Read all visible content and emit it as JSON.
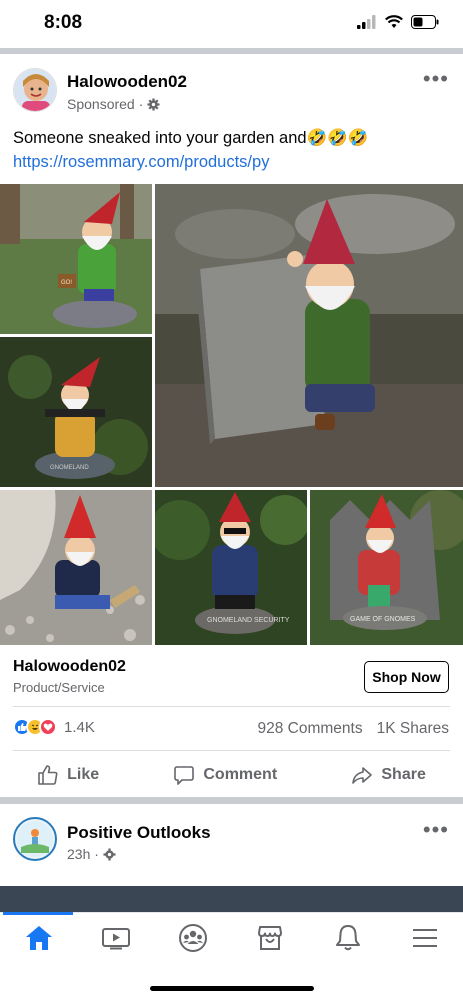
{
  "status_bar": {
    "time": "8:08"
  },
  "post": {
    "author": "Halowooden02",
    "meta": "Sponsored ·",
    "text_before_link": "Someone sneaked into your garden and🤣🤣🤣",
    "link_text": "https://rosemmary.com/products/py",
    "gnome_signs": [
      "GNOMELAND SECURITY",
      "GAME OF GNOMES"
    ],
    "cta": {
      "name": "Halowooden02",
      "category": "Product/Service",
      "button": "Shop Now"
    },
    "reactions_count": "1.4K",
    "comments": "928 Comments",
    "shares": "1K Shares",
    "actions": {
      "like": "Like",
      "comment": "Comment",
      "share": "Share"
    }
  },
  "post2": {
    "author": "Positive Outlooks",
    "meta": "23h ·"
  },
  "colors": {
    "accent": "#1877f2",
    "link": "#216fdb",
    "secondary_text": "#65676b"
  },
  "tabs": [
    "home-icon",
    "video-icon",
    "groups-icon",
    "marketplace-icon",
    "notifications-icon",
    "menu-icon"
  ]
}
